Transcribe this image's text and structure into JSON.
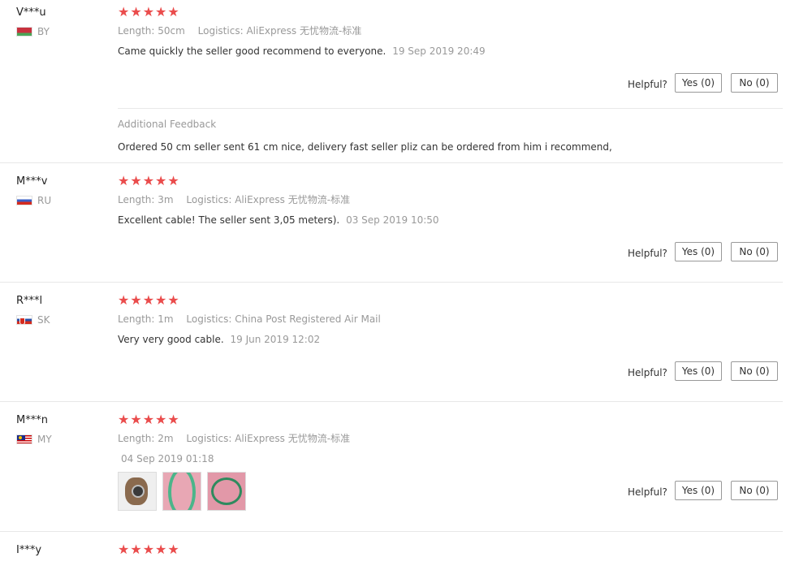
{
  "labels": {
    "length_key": "Length:",
    "logistics_key": "Logistics:",
    "helpful": "Helpful?",
    "yes": "Yes (0)",
    "no": "No (0)",
    "additional_feedback": "Additional Feedback"
  },
  "reviews": [
    {
      "user": "V***u",
      "country": "BY",
      "stars": "★★★★★",
      "rating": 5,
      "length": "50cm",
      "logistics": "AliExpress 无忧物流-标准",
      "text": "Came quickly the seller good recommend to everyone.",
      "date": "19 Sep 2019 20:49",
      "additional_feedback": "Ordered 50 cm seller sent 61 cm nice, delivery fast seller pliz can be ordered from him i recommend,"
    },
    {
      "user": "M***v",
      "country": "RU",
      "stars": "★★★★★",
      "rating": 5,
      "length": "3m",
      "logistics": "AliExpress 无忧物流-标准",
      "text": "Excellent cable! The seller sent 3,05 meters).",
      "date": "03 Sep 2019 10:50"
    },
    {
      "user": "R***l",
      "country": "SK",
      "stars": "★★★★★",
      "rating": 5,
      "length": "1m",
      "logistics": "China Post Registered Air Mail",
      "text": "Very very good cable.",
      "date": "19 Jun 2019 12:02"
    },
    {
      "user": "M***n",
      "country": "MY",
      "stars": "★★★★★",
      "rating": 5,
      "length": "2m",
      "logistics": "AliExpress 无忧物流-标准",
      "date": "04 Sep 2019 01:18"
    },
    {
      "user": "I***y",
      "stars": "★★★★★",
      "rating": 5
    }
  ],
  "colors": {
    "star": "#ea4c4c",
    "muted_text": "#999999",
    "body_text": "#333333",
    "divider": "#e8e8e8"
  }
}
